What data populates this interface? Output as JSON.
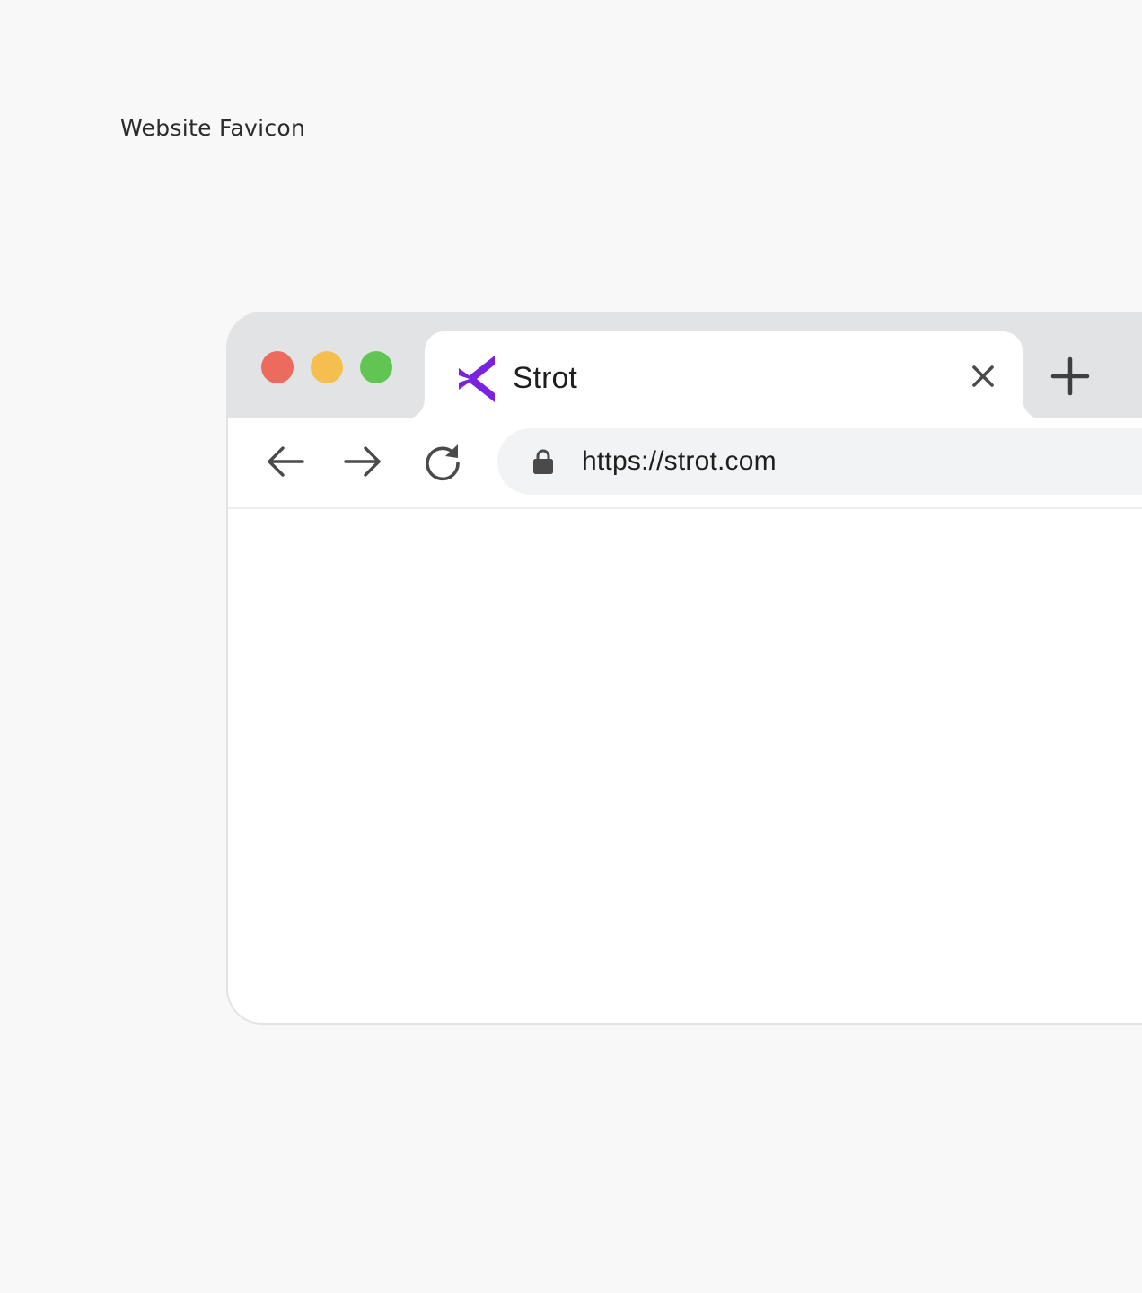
{
  "caption": "Website Favicon",
  "browser": {
    "tab": {
      "title": "Strot",
      "favicon": "strot-logo-icon",
      "close_icon": "close-icon"
    },
    "new_tab_icon": "plus-icon",
    "toolbar": {
      "back_icon": "arrow-left-icon",
      "forward_icon": "arrow-right-icon",
      "reload_icon": "reload-icon",
      "lock_icon": "lock-icon",
      "url": "https://strot.com"
    }
  },
  "colors": {
    "page_background": "#f8f8f8",
    "tabstrip": "#e2e3e5",
    "omnibox": "#f1f3f4",
    "traffic_red": "#ec6a5e",
    "traffic_yellow": "#f5bf4f",
    "traffic_green": "#61c554",
    "favicon_purple": "#7a22e0",
    "icon_gray": "#4a4a4a"
  }
}
